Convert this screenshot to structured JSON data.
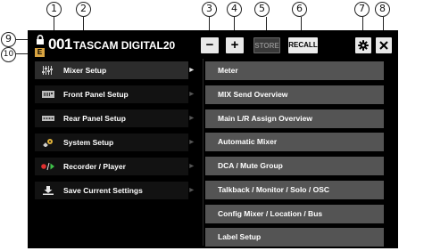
{
  "callouts": {
    "c1": "1",
    "c2": "2",
    "c3": "3",
    "c4": "4",
    "c5": "5",
    "c6": "6",
    "c7": "7",
    "c8": "8",
    "c9": "9",
    "c10": "10"
  },
  "header": {
    "scene_number": "001",
    "scene_name": "TASCAM DIGITAL20",
    "minus_label": "−",
    "plus_label": "+",
    "store_label": "STORE",
    "recall_label": "RECALL",
    "e_badge": "E",
    "lock_icon": "lock-icon",
    "gear_icon": "gear-icon",
    "close_icon": "close-icon"
  },
  "menu": {
    "items": [
      {
        "label": "Mixer Setup",
        "icon": "mixer-faders-icon",
        "active": true
      },
      {
        "label": "Front Panel Setup",
        "icon": "front-panel-icon"
      },
      {
        "label": "Rear Panel Setup",
        "icon": "rear-panel-icon"
      },
      {
        "label": "System Setup",
        "icon": "system-gear-icon"
      },
      {
        "label": "Recorder / Player",
        "icon": "record-play-icon"
      },
      {
        "label": "Save Current Settings",
        "icon": "save-download-icon"
      }
    ],
    "arrow": "▶"
  },
  "submenu": {
    "items": [
      "Meter",
      "MIX Send Overview",
      "Main L/R Assign Overview",
      "Automatic Mixer",
      "DCA / Mute Group",
      "Talkback / Monitor / Solo / OSC",
      "Config Mixer / Location / Bus",
      "Label Setup"
    ]
  },
  "colors": {
    "background": "#000000",
    "submenu_bg": "#545454",
    "active_menu_bg": "#2c2c2c",
    "button_bg": "#e8e8e8",
    "e_badge": "#d9a441"
  }
}
